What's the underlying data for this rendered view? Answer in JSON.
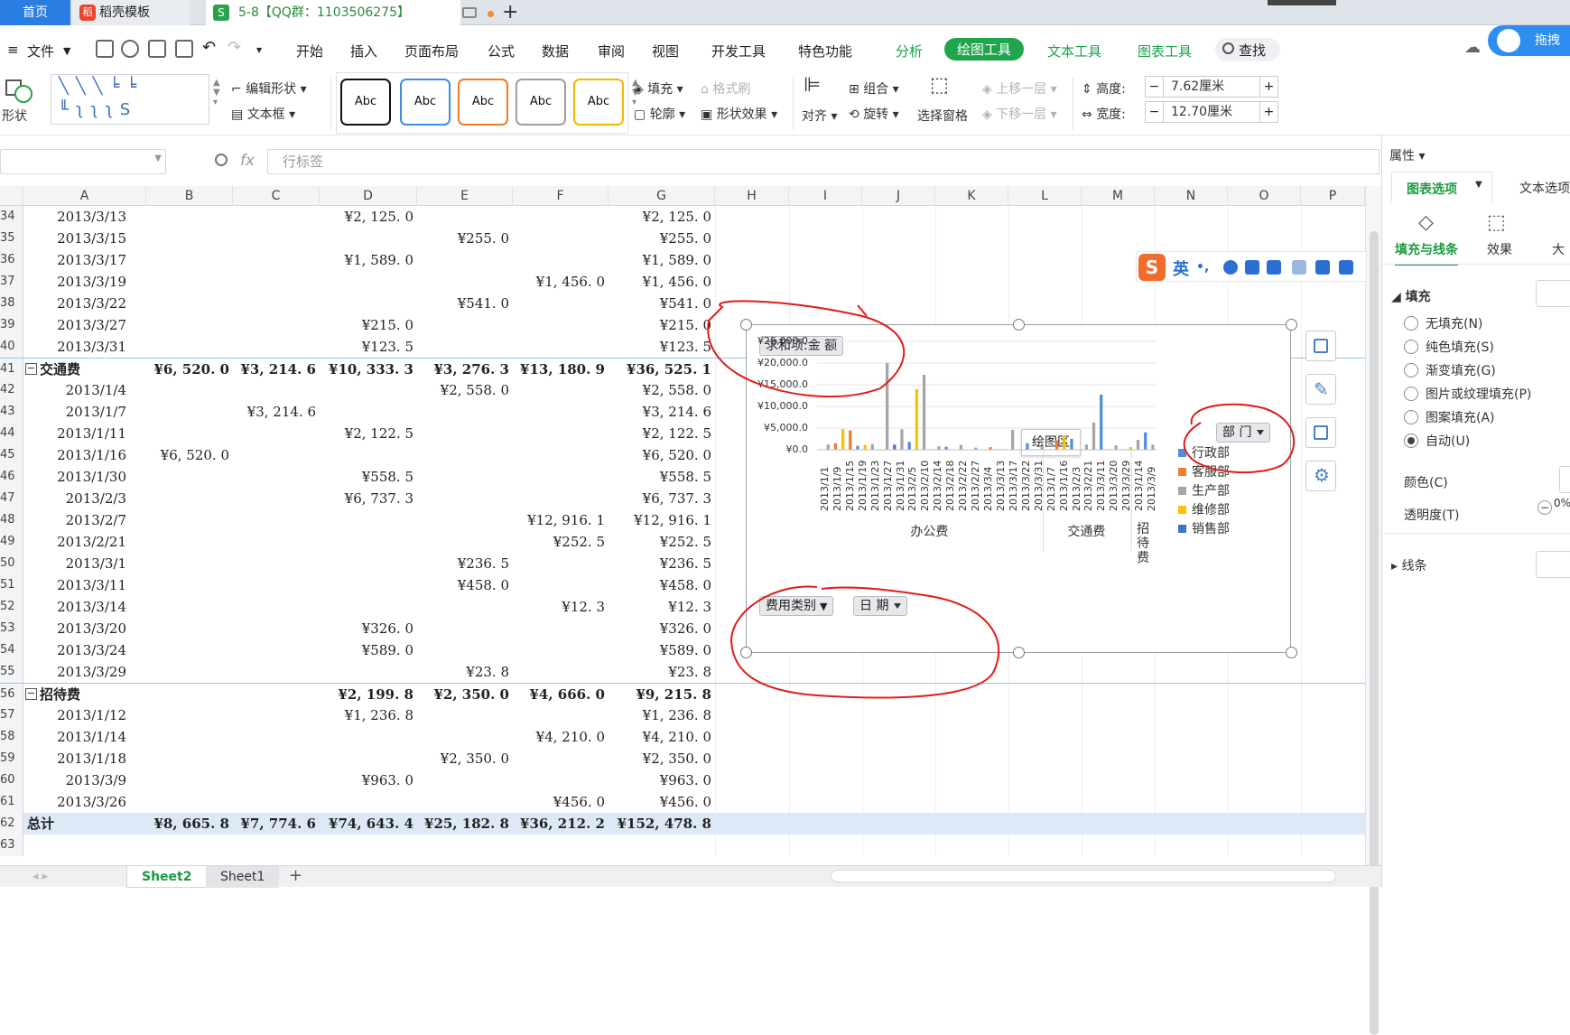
{
  "tabs": {
    "home": "首页",
    "template": "稻壳模板",
    "file": "5-8【QQ群：1103506275】",
    "plus": "+"
  },
  "menu": {
    "file": "文件",
    "start": "开始",
    "insert": "插入",
    "layout": "页面布局",
    "formula": "公式",
    "data": "数据",
    "review": "审阅",
    "view": "视图",
    "dev": "开发工具",
    "special": "特色功能",
    "analyze": "分析",
    "draw": "绘图工具",
    "text": "文本工具",
    "chart": "图表工具",
    "search": "查找",
    "cloud": "拖拽上"
  },
  "ribbon": {
    "shape": "形状",
    "edit_shape": "编辑形状",
    "textbox": "文本框",
    "abc": [
      "Abc",
      "Abc",
      "Abc",
      "Abc",
      "Abc"
    ],
    "abc_colors": [
      "#111111",
      "#3a8ee6",
      "#f07a1e",
      "#9aa0a6",
      "#f5b800"
    ],
    "fill": "填充",
    "format_brush": "格式刷",
    "outline": "轮廓",
    "shape_effect": "形状效果",
    "align": "对齐",
    "group": "组合",
    "rotate": "旋转",
    "select_pane": "选择窗格",
    "bring_forward": "上移一层",
    "send_backward": "下移一层",
    "height_label": "高度:",
    "height_value": "7.62厘米",
    "width_label": "宽度:",
    "width_value": "12.70厘米"
  },
  "formula": {
    "fx": "fx",
    "content": "行标签"
  },
  "columns": [
    "A",
    "B",
    "C",
    "D",
    "E",
    "F",
    "G",
    "H",
    "I",
    "J",
    "K",
    "L",
    "M",
    "N",
    "O",
    "P"
  ],
  "rows": [
    {
      "n": "34",
      "a": "2013/3/13",
      "d": "¥2, 125. 0",
      "g": "¥2, 125. 0"
    },
    {
      "n": "35",
      "a": "2013/3/15",
      "e": "¥255. 0",
      "g": "¥255. 0"
    },
    {
      "n": "36",
      "a": "2013/3/17",
      "d": "¥1, 589. 0",
      "g": "¥1, 589. 0"
    },
    {
      "n": "37",
      "a": "2013/3/19",
      "f": "¥1, 456. 0",
      "g": "¥1, 456. 0"
    },
    {
      "n": "38",
      "a": "2013/3/22",
      "e": "¥541. 0",
      "g": "¥541. 0"
    },
    {
      "n": "39",
      "a": "2013/3/27",
      "d": "¥215. 0",
      "g": "¥215. 0"
    },
    {
      "n": "40",
      "a": "2013/3/31",
      "d": "¥123. 5",
      "g": "¥123. 5"
    },
    {
      "n": "41",
      "a": "交通费",
      "group": true,
      "b": "¥6, 520. 0",
      "c": "¥3, 214. 6",
      "d": "¥10, 333. 3",
      "e": "¥3, 276. 3",
      "f": "¥13, 180. 9",
      "g": "¥36, 525. 1"
    },
    {
      "n": "42",
      "a": "2013/1/4",
      "e": "¥2, 558. 0",
      "g": "¥2, 558. 0"
    },
    {
      "n": "43",
      "a": "2013/1/7",
      "c": "¥3, 214. 6",
      "g": "¥3, 214. 6"
    },
    {
      "n": "44",
      "a": "2013/1/11",
      "d": "¥2, 122. 5",
      "g": "¥2, 122. 5"
    },
    {
      "n": "45",
      "a": "2013/1/16",
      "b": "¥6, 520. 0",
      "g": "¥6, 520. 0"
    },
    {
      "n": "46",
      "a": "2013/1/30",
      "d": "¥558. 5",
      "g": "¥558. 5"
    },
    {
      "n": "47",
      "a": "2013/2/3",
      "d": "¥6, 737. 3",
      "g": "¥6, 737. 3"
    },
    {
      "n": "48",
      "a": "2013/2/7",
      "f": "¥12, 916. 1",
      "g": "¥12, 916. 1"
    },
    {
      "n": "49",
      "a": "2013/2/21",
      "f": "¥252. 5",
      "g": "¥252. 5"
    },
    {
      "n": "50",
      "a": "2013/3/1",
      "e": "¥236. 5",
      "g": "¥236. 5"
    },
    {
      "n": "51",
      "a": "2013/3/11",
      "e": "¥458. 0",
      "g": "¥458. 0"
    },
    {
      "n": "52",
      "a": "2013/3/14",
      "f": "¥12. 3",
      "g": "¥12. 3"
    },
    {
      "n": "53",
      "a": "2013/3/20",
      "d": "¥326. 0",
      "g": "¥326. 0"
    },
    {
      "n": "54",
      "a": "2013/3/24",
      "d": "¥589. 0",
      "g": "¥589. 0"
    },
    {
      "n": "55",
      "a": "2013/3/29",
      "e": "¥23. 8",
      "g": "¥23. 8"
    },
    {
      "n": "56",
      "a": "招待费",
      "group": true,
      "d": "¥2, 199. 8",
      "e": "¥2, 350. 0",
      "f": "¥4, 666. 0",
      "g": "¥9, 215. 8"
    },
    {
      "n": "57",
      "a": "2013/1/12",
      "d": "¥1, 236. 8",
      "g": "¥1, 236. 8"
    },
    {
      "n": "58",
      "a": "2013/1/14",
      "f": "¥4, 210. 0",
      "g": "¥4, 210. 0"
    },
    {
      "n": "59",
      "a": "2013/1/18",
      "e": "¥2, 350. 0",
      "g": "¥2, 350. 0"
    },
    {
      "n": "60",
      "a": "2013/3/9",
      "d": "¥963. 0",
      "g": "¥963. 0"
    },
    {
      "n": "61",
      "a": "2013/3/26",
      "f": "¥456. 0",
      "g": "¥456. 0"
    },
    {
      "n": "62",
      "a": "总计",
      "total": true,
      "b": "¥8, 665. 8",
      "c": "¥7, 774. 6",
      "d": "¥74, 643. 4",
      "e": "¥25, 182. 8",
      "f": "¥36, 212. 2",
      "g": "¥152, 478. 8"
    },
    {
      "n": "63",
      "a": ""
    }
  ],
  "sheets": {
    "active": "Sheet2",
    "other": "Sheet1"
  },
  "chart_data": {
    "type": "bar",
    "value_field": "求和项:金 额",
    "legend_title": "部 门",
    "tooltip": "绘图区",
    "filter_category": "费用类别",
    "filter_date": "日 期",
    "yticks": [
      "¥25,000.0",
      "¥20,000.0",
      "¥15,000.0",
      "¥10,000.0",
      "¥5,000.0",
      "¥0.0"
    ],
    "ylim": [
      0,
      25000
    ],
    "series": [
      {
        "name": "行政部",
        "color": "#4e8fd8"
      },
      {
        "name": "客服部",
        "color": "#ed7d31"
      },
      {
        "name": "生产部",
        "color": "#a5a5a5"
      },
      {
        "name": "维修部",
        "color": "#ffc000"
      },
      {
        "name": "销售部",
        "color": "#4472c4"
      }
    ],
    "x_labels": [
      "2013/1/1",
      "2013/1/9",
      "2013/1/15",
      "2013/1/19",
      "2013/1/23",
      "2013/1/27",
      "2013/1/31",
      "2013/2/5",
      "2013/2/10",
      "2013/2/14",
      "2013/2/18",
      "2013/2/22",
      "2013/2/27",
      "2013/3/4",
      "2013/3/13",
      "2013/3/17",
      "2013/3/22",
      "2013/3/31",
      "2013/1/7",
      "2013/1/16",
      "2013/2/3",
      "2013/2/21",
      "2013/3/11",
      "2013/3/20",
      "2013/3/29",
      "2013/1/14",
      "2013/3/9"
    ],
    "categories": [
      "办公费",
      "交通费",
      "招待费"
    ],
    "bars": [
      {
        "i": 1,
        "s": 2,
        "v": 1200
      },
      {
        "i": 2,
        "s": 1,
        "v": 1500
      },
      {
        "i": 3,
        "s": 3,
        "v": 4800
      },
      {
        "i": 4,
        "s": 1,
        "v": 4500
      },
      {
        "i": 5,
        "s": 0,
        "v": 900
      },
      {
        "i": 6,
        "s": 3,
        "v": 1100
      },
      {
        "i": 7,
        "s": 2,
        "v": 1300
      },
      {
        "i": 9,
        "s": 2,
        "v": 20000
      },
      {
        "i": 10,
        "s": 4,
        "v": 1200
      },
      {
        "i": 11,
        "s": 2,
        "v": 4700
      },
      {
        "i": 12,
        "s": 0,
        "v": 1800
      },
      {
        "i": 13,
        "s": 3,
        "v": 14000
      },
      {
        "i": 14,
        "s": 2,
        "v": 17300
      },
      {
        "i": 16,
        "s": 2,
        "v": 800
      },
      {
        "i": 17,
        "s": 0,
        "v": 700
      },
      {
        "i": 19,
        "s": 2,
        "v": 1100
      },
      {
        "i": 21,
        "s": 2,
        "v": 500
      },
      {
        "i": 23,
        "s": 1,
        "v": 600
      },
      {
        "i": 26,
        "s": 2,
        "v": 4600
      },
      {
        "i": 28,
        "s": 0,
        "v": 1500
      },
      {
        "i": 30,
        "s": 2,
        "v": 900
      },
      {
        "i": 32,
        "s": 1,
        "v": 2200
      },
      {
        "i": 33,
        "s": 3,
        "v": 3200
      },
      {
        "i": 34,
        "s": 0,
        "v": 2500
      },
      {
        "i": 36,
        "s": 2,
        "v": 1200
      },
      {
        "i": 37,
        "s": 2,
        "v": 6300
      },
      {
        "i": 38,
        "s": 0,
        "v": 12700
      },
      {
        "i": 40,
        "s": 2,
        "v": 1000
      },
      {
        "i": 42,
        "s": 3,
        "v": 600
      },
      {
        "i": 43,
        "s": 2,
        "v": 2300
      },
      {
        "i": 44,
        "s": 0,
        "v": 4000
      },
      {
        "i": 45,
        "s": 2,
        "v": 1200
      }
    ]
  },
  "ime": {
    "lang": "英"
  },
  "rpanel": {
    "title": "属性",
    "tab_chart": "图表选项",
    "tab_text": "文本选项",
    "fill_line": "填充与线条",
    "effect": "效果",
    "size": "大",
    "fill": "填充",
    "opts": [
      "无填充(N)",
      "纯色填充(S)",
      "渐变填充(G)",
      "图片或纹理填充(P)",
      "图案填充(A)",
      "自动(U)"
    ],
    "color": "颜色(C)",
    "transparency": "透明度(T)",
    "transparency_value": "0%",
    "line": "线条"
  }
}
